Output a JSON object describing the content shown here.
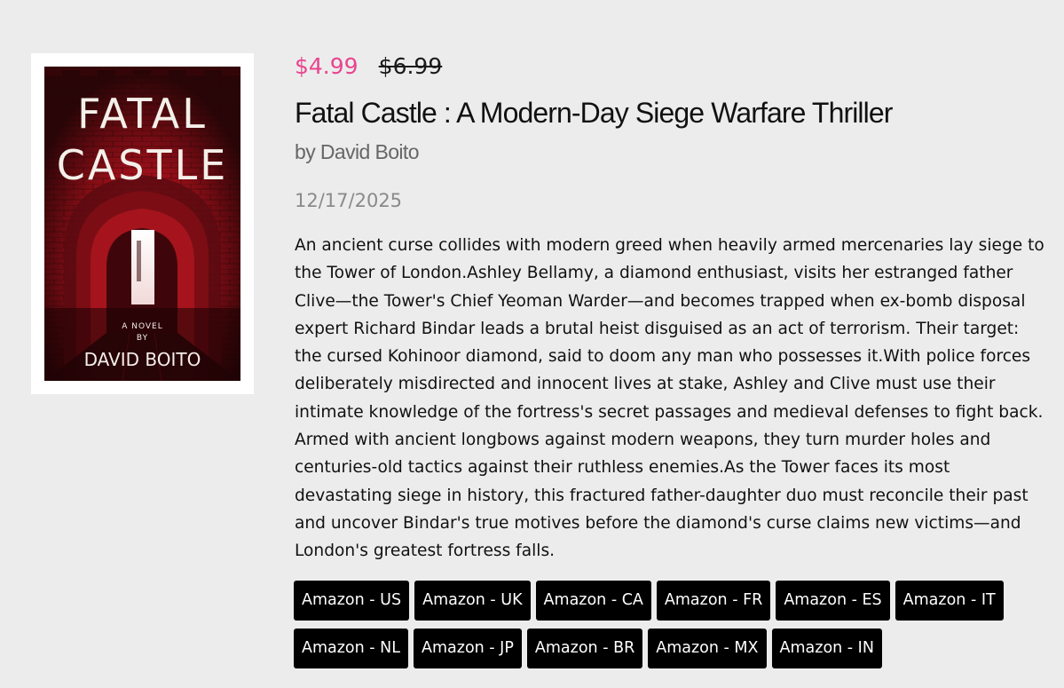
{
  "colors": {
    "page_background": "#ececec",
    "sale_price": "#e8448f",
    "button_background": "#000000",
    "button_text": "#ffffff",
    "cover_red": "#b0121a"
  },
  "cover": {
    "title_line1": "FATAL",
    "title_line2": "CASTLE",
    "tagline_line1": "A NOVEL",
    "tagline_line2": "BY",
    "author": "DAVID BOITO"
  },
  "book": {
    "price_current": "$4.99",
    "price_original": "$6.99",
    "title": "Fatal Castle : A Modern-Day Siege Warfare Thriller",
    "author_line": "by David Boito",
    "date": "12/17/2025",
    "description": "An ancient curse collides with modern greed when heavily armed mercenaries lay siege to the Tower of London.Ashley Bellamy, a diamond enthusiast, visits her estranged father Clive—the Tower's Chief Yeoman Warder—and becomes trapped when ex-bomb disposal expert Richard Bindar leads a brutal heist disguised as an act of terrorism. Their target: the cursed Kohinoor diamond, said to doom any man who possesses it.With police forces deliberately misdirected and innocent lives at stake, Ashley and Clive must use their intimate knowledge of the fortress's secret passages and medieval defenses to fight back. Armed with ancient longbows against modern weapons, they turn murder holes and centuries-old tactics against their ruthless enemies.As the Tower faces its most devastating siege in history, this fractured father-daughter duo must reconcile their past and uncover Bindar's true motives before the diamond's curse claims new victims—and London's greatest fortress falls."
  },
  "stores": [
    {
      "label": "Amazon - US"
    },
    {
      "label": "Amazon - UK"
    },
    {
      "label": "Amazon - CA"
    },
    {
      "label": "Amazon - FR"
    },
    {
      "label": "Amazon - ES"
    },
    {
      "label": "Amazon - IT"
    },
    {
      "label": "Amazon - NL"
    },
    {
      "label": "Amazon - JP"
    },
    {
      "label": "Amazon - BR"
    },
    {
      "label": "Amazon - MX"
    },
    {
      "label": "Amazon - IN"
    }
  ]
}
